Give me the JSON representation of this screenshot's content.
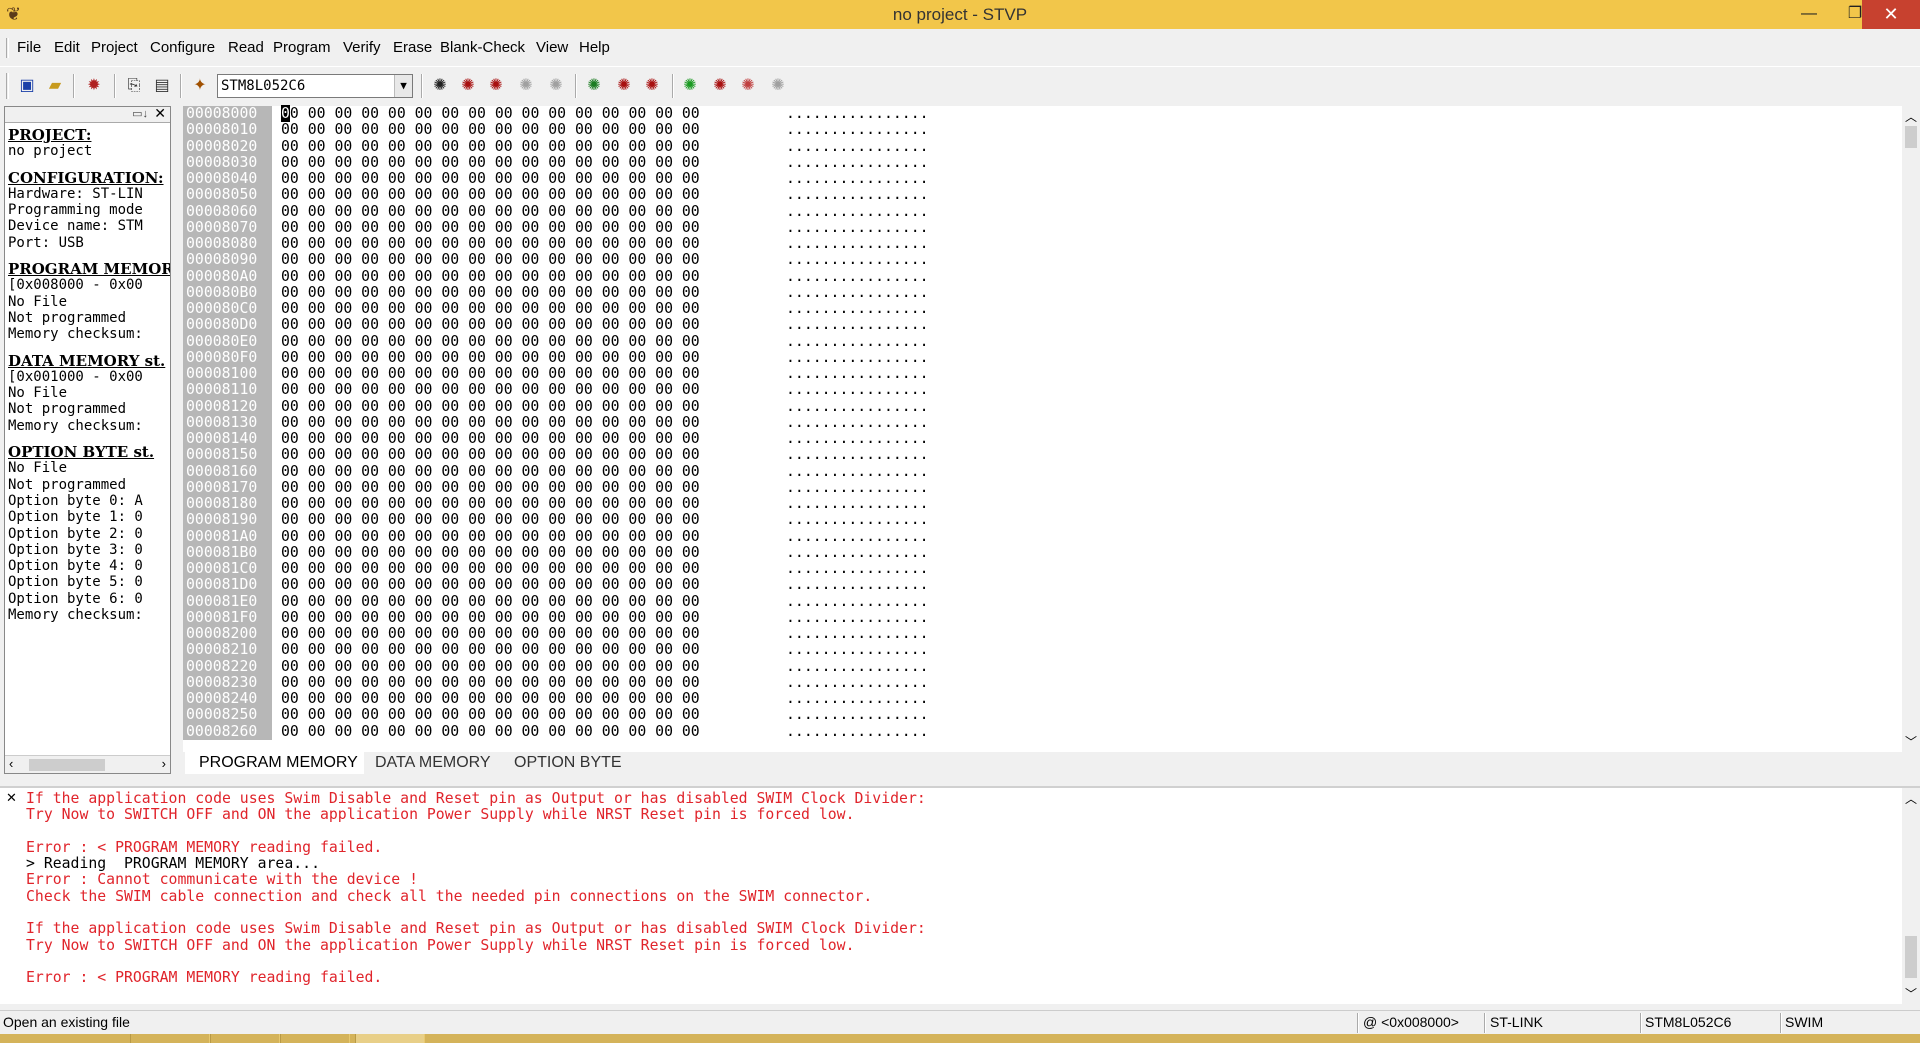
{
  "window": {
    "title": "no project - STVP",
    "minimize": "—",
    "maximize": "❐",
    "close": "✕"
  },
  "menu": {
    "items": [
      "File",
      "Edit",
      "Project",
      "Configure",
      "Read",
      "Program",
      "Verify",
      "Erase",
      "Blank-Check",
      "View",
      "Help"
    ]
  },
  "toolbar": {
    "device": "STM8L052C6",
    "icons": [
      "save-icon",
      "open-icon",
      "project-icon",
      "copy-icon",
      "paste-icon",
      "device-icon",
      "read-icon",
      "read-all-icon",
      "read-current-icon",
      "program-icon",
      "program-all-icon",
      "program-current-icon",
      "verify-icon",
      "verify-all-icon",
      "erase-icon",
      "erase-all-icon"
    ]
  },
  "left_panel": {
    "sections": [
      {
        "header": "PROJECT:",
        "lines": [
          "no project"
        ]
      },
      {
        "header": "CONFIGURATION:",
        "lines": [
          "Hardware: ST-LIN",
          "Programming mode",
          "Device name: STM",
          "Port: USB"
        ]
      },
      {
        "header": "PROGRAM MEMORY",
        "lines": [
          "[0x008000 - 0x00",
          "No File",
          "Not programmed",
          "Memory checksum:"
        ]
      },
      {
        "header": "DATA MEMORY st.",
        "lines": [
          "[0x001000 - 0x00",
          "No File",
          "Not programmed",
          "Memory checksum:"
        ]
      },
      {
        "header": "OPTION BYTE st.",
        "lines": [
          "No File",
          "Not programmed",
          "Option byte 0: A",
          "Option byte 1: 0",
          "Option byte 2: 0",
          "Option byte 3: 0",
          "Option byte 4: 0",
          "Option byte 5: 0",
          "Option byte 6: 0",
          "Memory checksum:"
        ]
      }
    ]
  },
  "hex": {
    "addresses": [
      "00008000",
      "00008010",
      "00008020",
      "00008030",
      "00008040",
      "00008050",
      "00008060",
      "00008070",
      "00008080",
      "00008090",
      "000080A0",
      "000080B0",
      "000080C0",
      "000080D0",
      "000080E0",
      "000080F0",
      "00008100",
      "00008110",
      "00008120",
      "00008130",
      "00008140",
      "00008150",
      "00008160",
      "00008170",
      "00008180",
      "00008190",
      "000081A0",
      "000081B0",
      "000081C0",
      "000081D0",
      "000081E0",
      "000081F0",
      "00008200",
      "00008210",
      "00008220",
      "00008230",
      "00008240",
      "00008250",
      "00008260"
    ],
    "bytes": "00 00 00 00 00 00 00 00 00 00 00 00 00 00 00 00",
    "ascii": "................"
  },
  "tabs": [
    "PROGRAM MEMORY",
    "DATA MEMORY",
    "OPTION BYTE"
  ],
  "log": [
    {
      "text": "If the application code uses Swim Disable and Reset pin as Output or has disabled SWIM Clock Divider:",
      "color": "red"
    },
    {
      "text": "Try Now to SWITCH OFF and ON the application Power Supply while NRST Reset pin is forced low.",
      "color": "red"
    },
    {
      "text": "",
      "color": "red"
    },
    {
      "text": "Error : < PROGRAM MEMORY reading failed.",
      "color": "red"
    },
    {
      "text": "> Reading  PROGRAM MEMORY area...",
      "color": "black"
    },
    {
      "text": "Error : Cannot communicate with the device !",
      "color": "red"
    },
    {
      "text": "Check the SWIM cable connection and check all the needed pin connections on the SWIM connector.",
      "color": "red"
    },
    {
      "text": "",
      "color": "red"
    },
    {
      "text": "If the application code uses Swim Disable and Reset pin as Output or has disabled SWIM Clock Divider:",
      "color": "red"
    },
    {
      "text": "Try Now to SWITCH OFF and ON the application Power Supply while NRST Reset pin is forced low.",
      "color": "red"
    },
    {
      "text": "",
      "color": "red"
    },
    {
      "text": "Error : < PROGRAM MEMORY reading failed.",
      "color": "red"
    }
  ],
  "status": {
    "message": "Open an existing file",
    "address": "@ <0x008000>",
    "hardware": "ST-LINK",
    "device": "STM8L052C6",
    "mode": "SWIM"
  },
  "colors": {
    "titlebar": "#f2c64a",
    "close": "#c7412f",
    "log_error": "#e0242b",
    "address_bg": "#b7b7b7"
  }
}
